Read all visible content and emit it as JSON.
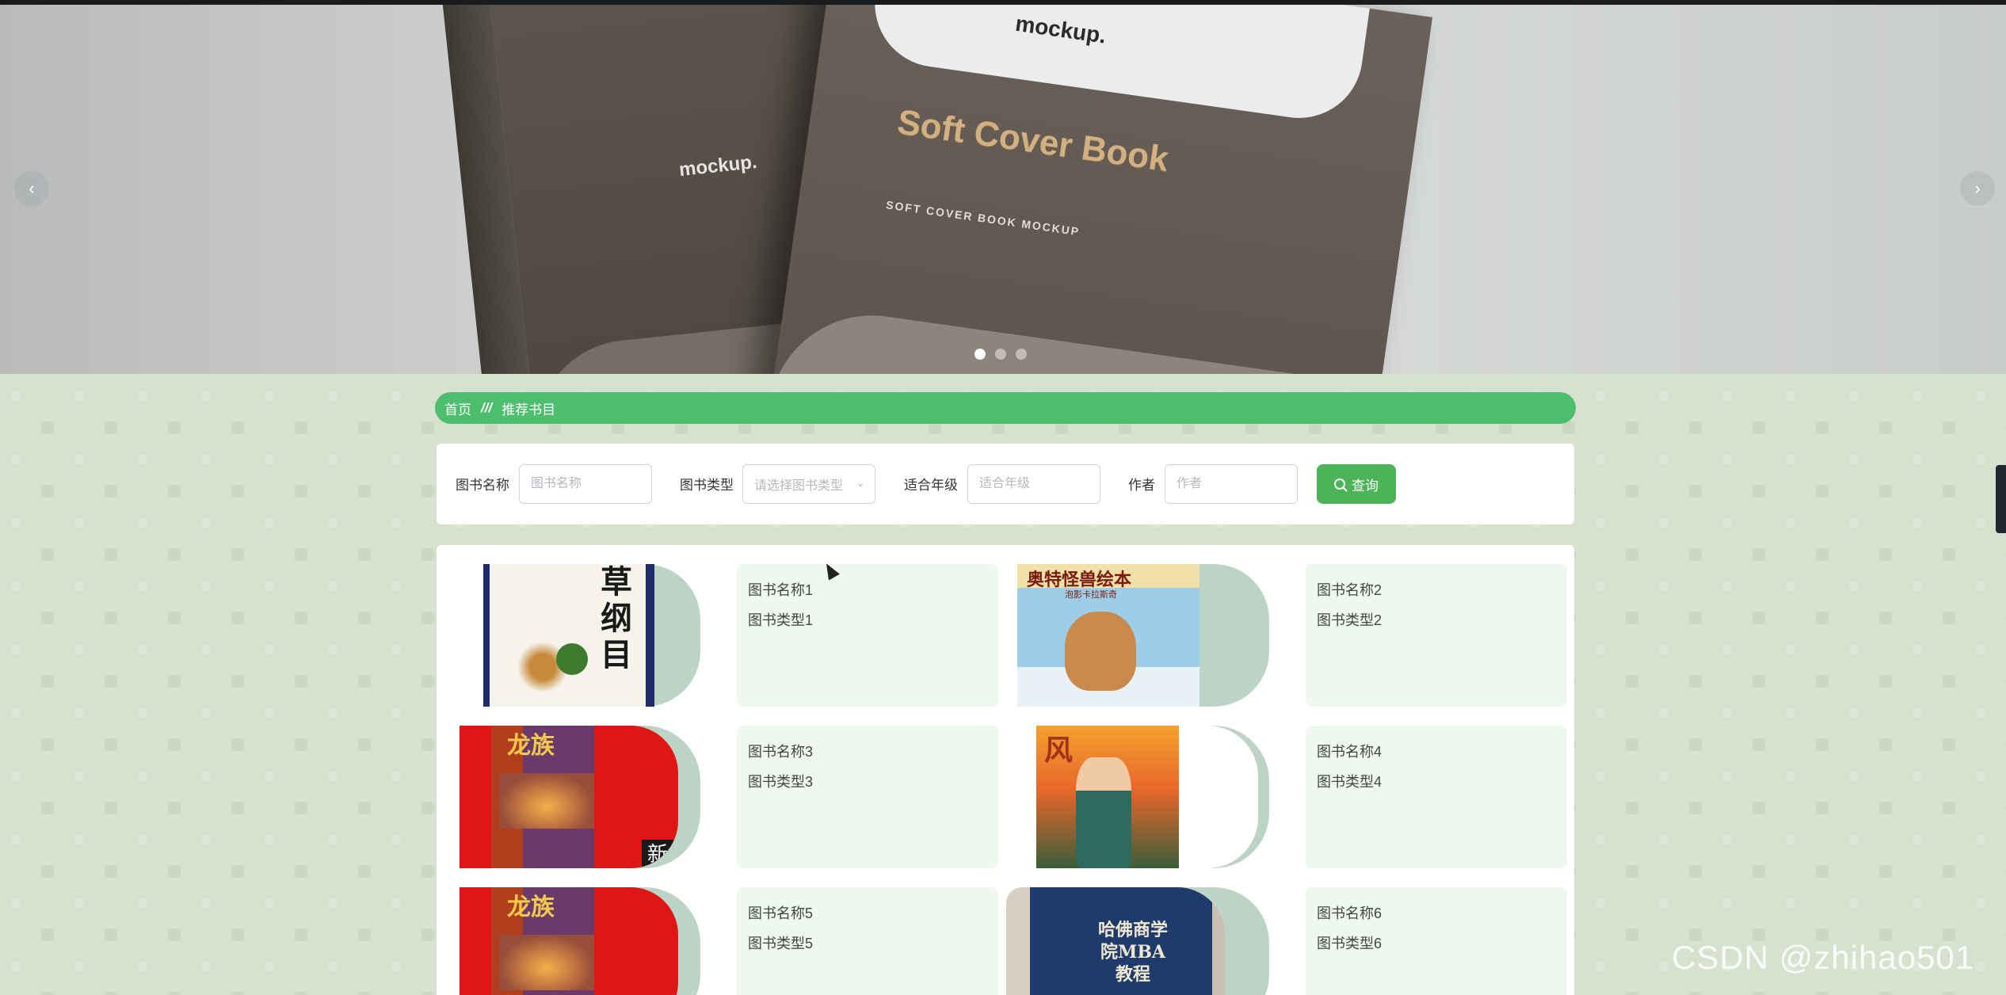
{
  "banner": {
    "back_book_logo": "mockup.",
    "front_book_logo": "mockup.",
    "front_book_title": "Soft Cover Book",
    "front_book_subtitle": "SOFT COVER BOOK MOCKUP",
    "prev_label": "‹",
    "next_label": "›",
    "slides_count": 3,
    "active_slide": 1
  },
  "breadcrumb": {
    "home": "首页",
    "separator": "///",
    "current": "推荐书目"
  },
  "search": {
    "name_label": "图书名称",
    "name_placeholder": "图书名称",
    "type_label": "图书类型",
    "type_placeholder": "请选择图书类型",
    "grade_label": "适合年级",
    "grade_placeholder": "适合年级",
    "author_label": "作者",
    "author_placeholder": "作者",
    "query_button": "查询"
  },
  "books": [
    {
      "name": "图书名称1",
      "type": "图书类型1",
      "cover_title": "草纲目"
    },
    {
      "name": "图书名称2",
      "type": "图书类型2",
      "cover_title": "奥特怪兽绘本",
      "cover_subtitle": "泡影卡拉斯奇"
    },
    {
      "name": "图书名称3",
      "type": "图书类型3",
      "cover_title": "龙族",
      "cover_badge": "新"
    },
    {
      "name": "图书名称4",
      "type": "图书类型4",
      "cover_title": "风"
    },
    {
      "name": "图书名称5",
      "type": "图书类型5",
      "cover_title": "龙族"
    },
    {
      "name": "图书名称6",
      "type": "图书类型6",
      "cover_title": "哈佛商学院MBA教程"
    }
  ],
  "watermark": "CSDN @zhihao501",
  "colors": {
    "accent_green": "#4dbd6e",
    "button_green": "#4db359",
    "card_bg": "#eff8ef",
    "page_bg": "#d6e2cf"
  }
}
